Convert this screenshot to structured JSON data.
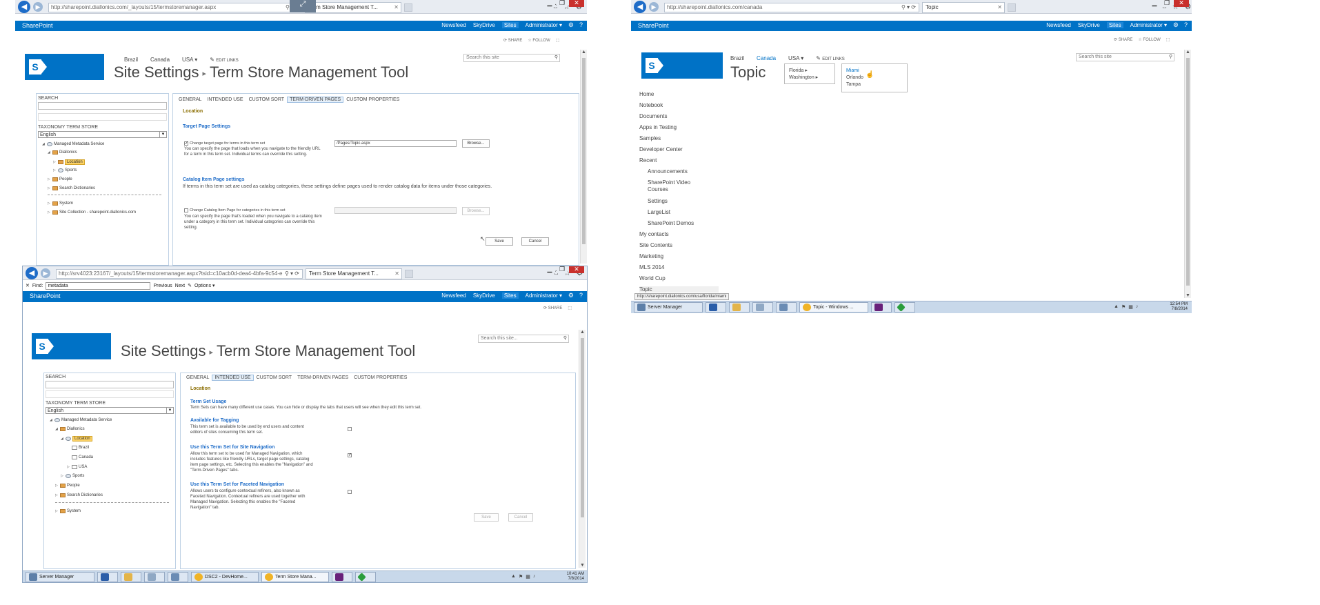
{
  "win1": {
    "url": "http://sharepoint.diallonics.com/_layouts/15/termstoremanager.aspx",
    "tab": "Term Store Management T...",
    "suite": {
      "brand": "SharePoint",
      "links": [
        "Newsfeed",
        "SkyDrive",
        "Sites"
      ],
      "user": "Administrator ▾"
    },
    "actions": [
      "SHARE",
      "FOLLOW"
    ],
    "topnav": [
      "Brazil",
      "Canada",
      "USA ▾"
    ],
    "edit_links": "EDIT LINKS",
    "title_a": "Site Settings",
    "title_b": "Term Store Management Tool",
    "search_placeholder": "Search this site",
    "tree": {
      "search_label": "SEARCH",
      "store_label": "TAXONOMY TERM STORE",
      "language": "English",
      "nodes": [
        "Managed Metadata Service",
        "Diallonics",
        "Location",
        "Sports",
        "People",
        "Search Dictionaries",
        "System",
        "Site Collection - sharepoint.diallonics.com"
      ]
    },
    "tabs": [
      "GENERAL",
      "INTENDED USE",
      "CUSTOM SORT",
      "TERM-DRIVEN PAGES",
      "CUSTOM PROPERTIES"
    ],
    "heading": "Location",
    "target_title": "Target Page Settings",
    "target_check": "Change target page for terms in this term set",
    "target_desc": "You can specify the page that loads when you navigate to the friendly URL for a term in this term set. Individual terms can override this setting.",
    "target_value": "/Pages/Topic.aspx",
    "browse": "Browse...",
    "catalog_title": "Catalog Item Page settings",
    "catalog_intro": "If terms in this term set are used as catalog categories, these settings define pages used to render catalog data for items under those categories.",
    "catalog_check": "Change Catalog Item Page for categories in this term set",
    "catalog_desc": "You can specify the page that's loaded when you navigate to a catalog item under a category in this term set. Individual categories can override this setting.",
    "save": "Save",
    "cancel": "Cancel"
  },
  "win2": {
    "url": "http://srv4023:23167/_layouts/15/termstoremanager.aspx?tsid=c10acb0d-dea4-4bfa-9c54-e",
    "tab": "Term Store Management T...",
    "find_label": "Find:",
    "find_value": "metadata",
    "find_prev": "Previous",
    "find_next": "Next",
    "find_options": "Options ▾",
    "suite": {
      "brand": "SharePoint",
      "links": [
        "Newsfeed",
        "SkyDrive",
        "Sites"
      ],
      "user": "Administrator ▾"
    },
    "actions": [
      "SHARE"
    ],
    "title_a": "Site Settings",
    "title_b": "Term Store Management Tool",
    "search_placeholder": "Search this site...",
    "tree": {
      "search_label": "SEARCH",
      "store_label": "TAXONOMY TERM STORE",
      "language": "English",
      "nodes": [
        "Managed Metadata Service",
        "Diallonics",
        "Location",
        "Brazil",
        "Canada",
        "USA",
        "Sports",
        "People",
        "Search Dictionaries",
        "System"
      ]
    },
    "tabs": [
      "GENERAL",
      "INTENDED USE",
      "CUSTOM SORT",
      "TERM-DRIVEN PAGES",
      "CUSTOM PROPERTIES"
    ],
    "heading": "Location",
    "usage_title": "Term Set Usage",
    "usage_desc": "Term Sets can have many different use cases. You can hide or display the tabs that users will see when they edit this term set.",
    "tag_title": "Available for Tagging",
    "tag_desc": "This term set is available to be used by end users and content editors of sites consuming this term set.",
    "nav_title": "Use this Term Set for Site Navigation",
    "nav_desc": "Allow this term set to be used for Managed Navigation, which includes features like friendly URLs, target page settings, catalog item page settings, etc. Selecting this enables the \"Navigation\" and \"Term-Driven Pages\" tabs.",
    "facet_title": "Use this Term Set for Faceted Navigation",
    "facet_desc": "Allows users to configure contextual refiners, also known as Faceted Navigation. Contextual refiners are used together with Managed Navigation. Selecting this enables the \"Faceted Navigation\" tab.",
    "save": "Save",
    "cancel": "Cancel",
    "taskbar": [
      "Server Manager",
      "DSC2 - DevHome...",
      "Term Store Mana..."
    ],
    "time": "10:41 AM",
    "date": "7/8/2014"
  },
  "win3": {
    "url": "http://sharepoint.diallonics.com/canada",
    "tab": "Topic",
    "suite": {
      "brand": "SharePoint",
      "links": [
        "Newsfeed",
        "SkyDrive",
        "Sites"
      ],
      "user": "Administrator ▾"
    },
    "actions": [
      "SHARE",
      "FOLLOW"
    ],
    "topnav": [
      "Brazil",
      "Canada",
      "USA ▾"
    ],
    "edit_links": "EDIT LINKS",
    "title": "Topic",
    "search_placeholder": "Search this site",
    "flyout1": [
      "Florida ▸",
      "Washington ▸"
    ],
    "flyout2": [
      "Miami",
      "Orlando",
      "Tampa"
    ],
    "quicklaunch": [
      "Home",
      "Notebook",
      "Documents",
      "Apps in Testing",
      "Samples",
      "Developer Center",
      "Recent",
      "Announcements",
      "SharePoint Video Courses",
      "Settings",
      "LargeList",
      "SharePoint Demos",
      "My contacts",
      "Site Contents",
      "Marketing",
      "MLS 2014",
      "World Cup",
      "Topic"
    ],
    "status_url": "http://sharepoint.diallonics.com/usa/florida/miami",
    "taskbar": [
      "Server Manager",
      "Topic - Windows ..."
    ],
    "time": "12:54 PM",
    "date": "7/8/2014"
  },
  "colors": {
    "suite": "#0072c6",
    "accent_link": "#1e6cc8",
    "highlight": "#fcd265",
    "taskbar": "#c8d8ea"
  }
}
